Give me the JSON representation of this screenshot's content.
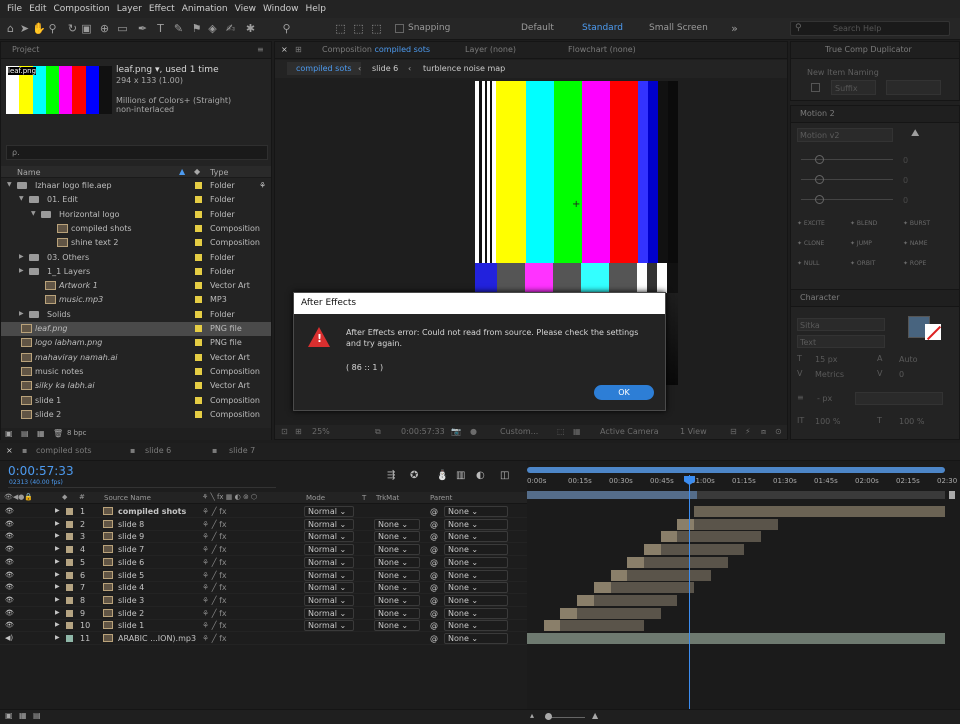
{
  "menu": [
    "File",
    "Edit",
    "Composition",
    "Layer",
    "Effect",
    "Animation",
    "View",
    "Window",
    "Help"
  ],
  "toolbar": {
    "snapping": "Snapping",
    "workspaces": [
      "Default",
      "Standard",
      "Small Screen"
    ],
    "active_workspace": "Standard",
    "search_placeholder": "Search Help"
  },
  "project": {
    "tab": "Project",
    "preview_file": "leaf.png",
    "preview_used": ", used 1 time",
    "preview_dims": "294 x 133 (1.00)",
    "preview_colors": "Millions of Colors+ (Straight)",
    "preview_interlace": "non-interlaced",
    "search_placeholder": "ρ.",
    "col_name": "Name",
    "col_type": "Type",
    "items": [
      {
        "name": "Izhaar logo file.aep",
        "type": "Folder",
        "color": "#e5cd44"
      },
      {
        "name": "01. Edit",
        "type": "Folder",
        "color": "#e5cd44"
      },
      {
        "name": "Horizontal logo",
        "type": "Folder",
        "color": "#e5cd44"
      },
      {
        "name": "compiled shots",
        "type": "Composition",
        "color": "#e5cd44"
      },
      {
        "name": "shine text 2",
        "type": "Composition",
        "color": "#e5cd44"
      },
      {
        "name": "03. Others",
        "type": "Folder",
        "color": "#e5cd44"
      },
      {
        "name": "1_1 Layers",
        "type": "Folder",
        "color": "#e5cd44"
      },
      {
        "name": "Artwork 1",
        "type": "Vector Art",
        "color": "#e5cd44"
      },
      {
        "name": "music.mp3",
        "type": "MP3",
        "color": "#e5cd44"
      },
      {
        "name": "Solids",
        "type": "Folder",
        "color": "#e5cd44"
      },
      {
        "name": "leaf.png",
        "type": "PNG file",
        "color": "#e5cd44"
      },
      {
        "name": "logo labham.png",
        "type": "PNG file",
        "color": "#e5cd44"
      },
      {
        "name": "mahaviray namah.ai",
        "type": "Vector Art",
        "color": "#e5cd44"
      },
      {
        "name": "music notes",
        "type": "Composition",
        "color": "#e5cd44"
      },
      {
        "name": "silky ka labh.ai",
        "type": "Vector Art",
        "color": "#e5cd44"
      },
      {
        "name": "slide 1",
        "type": "Composition",
        "color": "#e5cd44"
      },
      {
        "name": "slide 2",
        "type": "Composition",
        "color": "#e5cd44"
      }
    ],
    "bpc": "8 bpc"
  },
  "comp": {
    "tab_label": "Composition",
    "tab_name": "compiled sots",
    "layer_tab": "Layer (none)",
    "flowchart_tab": "Flowchart (none)",
    "breadcrumbs": [
      "compiled sots",
      "slide 6",
      "turblence noise map"
    ],
    "zoom": "25%",
    "timecode": "0:00:57:33",
    "resolution": "Custom...",
    "camera": "Active Camera",
    "views": "1 View"
  },
  "right": {
    "true_comp_tab": "True Comp Duplicator",
    "new_item_naming": "New Item Naming",
    "suffix": "Suffix",
    "motion_tab": "Motion 2",
    "motion_select": "Motion v2",
    "motion_zero": "0",
    "motion_buttons": [
      "EXCITE",
      "BLEND",
      "BURST",
      "CLONE",
      "JUMP",
      "NAME",
      "NULL",
      "ORBIT",
      "ROPE"
    ],
    "character_tab": "Character",
    "font": "Sitka",
    "style": "Text",
    "size": "15 px",
    "leading": "Auto",
    "kerning": "Metrics",
    "tracking": "0",
    "stroke": "- px",
    "vscale": "100 %",
    "hscale": "100 %",
    "baseline": "0 px",
    "tsume": "0 %",
    "color": "#48647f"
  },
  "timeline": {
    "tabs": [
      "compiled sots",
      "slide 6",
      "slide 7"
    ],
    "timecode": "0:00:57:33",
    "fps": "02313 (40.00 fps)",
    "ruler": [
      "0:00s",
      "00:15s",
      "00:30s",
      "00:45s",
      "01:00s",
      "01:15s",
      "01:30s",
      "01:45s",
      "02:00s",
      "02:15s",
      "02:30"
    ],
    "col_source": "Source Name",
    "col_mode": "Mode",
    "col_t": "T",
    "col_trkmat": "TrkMat",
    "col_parent": "Parent",
    "layers": [
      {
        "num": "1",
        "name": "compiled shots",
        "mode": "Normal",
        "trk": "",
        "parent": "None",
        "bold": true,
        "color": "#b5a482"
      },
      {
        "num": "2",
        "name": "slide 8",
        "mode": "Normal",
        "trk": "None",
        "parent": "None",
        "color": "#b5a482"
      },
      {
        "num": "3",
        "name": "slide 9",
        "mode": "Normal",
        "trk": "None",
        "parent": "None",
        "color": "#b5a482"
      },
      {
        "num": "4",
        "name": "slide 7",
        "mode": "Normal",
        "trk": "None",
        "parent": "None",
        "color": "#b5a482"
      },
      {
        "num": "5",
        "name": "slide 6",
        "mode": "Normal",
        "trk": "None",
        "parent": "None",
        "color": "#b5a482"
      },
      {
        "num": "6",
        "name": "slide 5",
        "mode": "Normal",
        "trk": "None",
        "parent": "None",
        "color": "#b5a482"
      },
      {
        "num": "7",
        "name": "slide 4",
        "mode": "Normal",
        "trk": "None",
        "parent": "None",
        "color": "#b5a482"
      },
      {
        "num": "8",
        "name": "slide 3",
        "mode": "Normal",
        "trk": "None",
        "parent": "None",
        "color": "#b5a482"
      },
      {
        "num": "9",
        "name": "slide 2",
        "mode": "Normal",
        "trk": "None",
        "parent": "None",
        "color": "#b5a482"
      },
      {
        "num": "10",
        "name": "slide 1",
        "mode": "Normal",
        "trk": "None",
        "parent": "None",
        "color": "#b5a482"
      },
      {
        "num": "11",
        "name": "ARABIC ...ION).mp3",
        "mode": "",
        "trk": "",
        "parent": "None",
        "color": "#8fb7a8"
      }
    ]
  },
  "dialog": {
    "title": "After Effects",
    "message": "After Effects error: Could not read from source. Please check the settings and try again.",
    "code": "( 86 :: 1 )",
    "ok": "OK"
  }
}
